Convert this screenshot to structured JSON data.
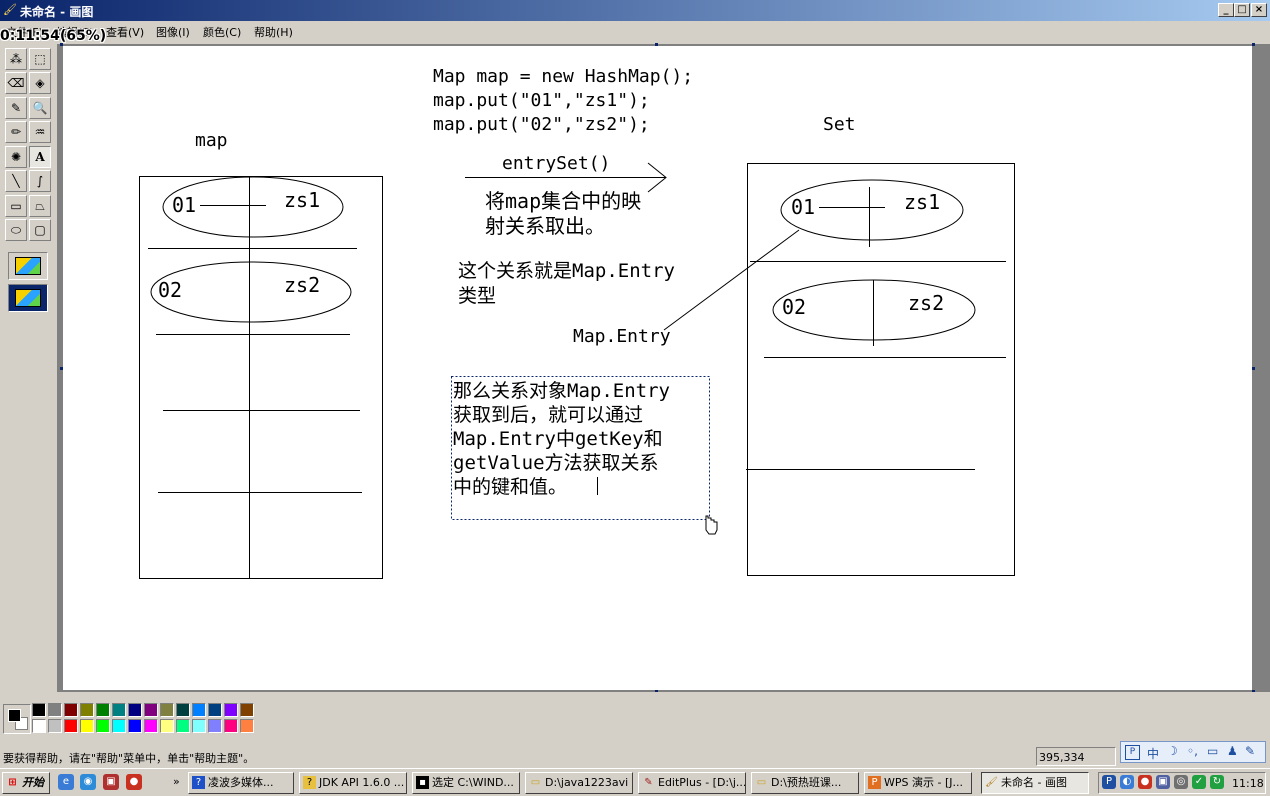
{
  "window": {
    "title": "未命名 - 画图",
    "buttons": [
      "_",
      "□",
      "×"
    ]
  },
  "timer": "0:11:54(65%)",
  "menu": [
    "文件(F)",
    "编辑(E)",
    "查看(V)",
    "图像(I)",
    "颜色(C)",
    "帮助(H)"
  ],
  "tools": [
    {
      "name": "free-select-tool",
      "glyph": "⁂"
    },
    {
      "name": "rect-select-tool",
      "glyph": "⬚"
    },
    {
      "name": "eraser-tool",
      "glyph": "⌫"
    },
    {
      "name": "fill-tool",
      "glyph": "◈"
    },
    {
      "name": "color-picker-tool",
      "glyph": "✎"
    },
    {
      "name": "magnifier-tool",
      "glyph": "🔍"
    },
    {
      "name": "pencil-tool",
      "glyph": "✏"
    },
    {
      "name": "brush-tool",
      "glyph": "♒"
    },
    {
      "name": "airbrush-tool",
      "glyph": "✺"
    },
    {
      "name": "text-tool",
      "glyph": "A"
    },
    {
      "name": "line-tool",
      "glyph": "╲"
    },
    {
      "name": "curve-tool",
      "glyph": "∫"
    },
    {
      "name": "rectangle-tool",
      "glyph": "▭"
    },
    {
      "name": "polygon-tool",
      "glyph": "⏢"
    },
    {
      "name": "ellipse-tool",
      "glyph": "⬭"
    },
    {
      "name": "rounded-rect-tool",
      "glyph": "▢"
    }
  ],
  "drawing": {
    "code_line1": "Map map = new HashMap();",
    "code_line2": "map.put(\"01\",\"zs1\");",
    "code_line3": "map.put(\"02\",\"zs2\");",
    "map_label": "map",
    "set_label": "Set",
    "entryset_label": "entrySet()",
    "note1_line1": "将map集合中的映",
    "note1_line2": "射关系取出。",
    "note2_line1": "这个关系就是Map.Entry",
    "note2_line2": "类型",
    "map_entry_label": "Map.Entry",
    "note3": [
      "那么关系对象Map.Entry",
      "获取到后，就可以通过",
      "Map.Entry中getKey和",
      "getValue方法获取关系",
      "中的键和值。"
    ],
    "key1": "01",
    "val1": "zs1",
    "key2": "02",
    "val2": "zs2"
  },
  "palette": [
    "#000000",
    "#808080",
    "#800000",
    "#808000",
    "#008000",
    "#008080",
    "#000080",
    "#800080",
    "#808040",
    "#004040",
    "#0080ff",
    "#004080",
    "#8000ff",
    "#804000",
    "#ffffff",
    "#c0c0c0",
    "#ff0000",
    "#ffff00",
    "#00ff00",
    "#00ffff",
    "#0000ff",
    "#ff00ff",
    "#ffff80",
    "#00ff80",
    "#80ffff",
    "#8080ff",
    "#ff0080",
    "#ff8040"
  ],
  "status": {
    "help": "要获得帮助，请在\"帮助\"菜单中，单击\"帮助主题\"。",
    "coords": "395,334"
  },
  "taskbar": {
    "start": "开始",
    "items": [
      "凌波多媒体...",
      "JDK API 1.6.0 ...",
      "选定 C:\\WIND...",
      "D:\\java1223avi",
      "EditPlus - [D:\\j...",
      "D:\\预热班课...",
      "WPS 演示 - [J...",
      "未命名 - 画图"
    ],
    "clock": "11:18",
    "ime": "中"
  }
}
